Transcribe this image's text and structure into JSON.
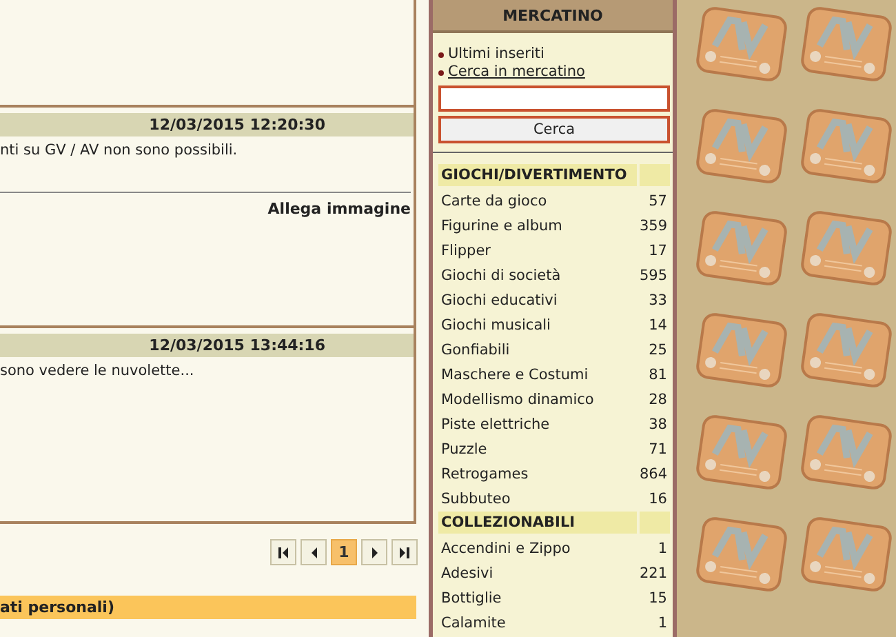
{
  "posts": [
    {
      "date": "12/03/2015 12:20:30",
      "text": "nti su GV / AV non sono possibili.",
      "attach_label": "Allega immagine"
    },
    {
      "date": "12/03/2015 13:44:16",
      "text": "sono vedere le nuvolette..."
    }
  ],
  "pagination": [
    {
      "kind": "first",
      "selected": false
    },
    {
      "kind": "prev",
      "selected": false
    },
    {
      "kind": "page",
      "label": "1",
      "selected": true
    },
    {
      "kind": "next",
      "selected": false
    },
    {
      "kind": "last",
      "selected": false
    }
  ],
  "footer_bar": {
    "text": "ati personali)"
  },
  "sidebar": {
    "title": "MERCATINO",
    "links": [
      "Ultimi inseriti",
      "Cerca in mercatino"
    ],
    "search_button": "Cerca",
    "groups": [
      {
        "title": "GIOCHI/DIVERTIMENTO",
        "items": [
          {
            "name": "Carte da gioco",
            "count": "57"
          },
          {
            "name": "Figurine e album",
            "count": "359"
          },
          {
            "name": "Flipper",
            "count": "17"
          },
          {
            "name": "Giochi di società",
            "count": "595"
          },
          {
            "name": "Giochi educativi",
            "count": "33"
          },
          {
            "name": "Giochi musicali",
            "count": "14"
          },
          {
            "name": "Gonfiabili",
            "count": "25"
          },
          {
            "name": "Maschere e Costumi",
            "count": "81"
          },
          {
            "name": "Modellismo dinamico",
            "count": "28"
          },
          {
            "name": "Piste elettriche",
            "count": "38"
          },
          {
            "name": "Puzzle",
            "count": "71"
          },
          {
            "name": "Retrogames",
            "count": "864"
          },
          {
            "name": "Subbuteo",
            "count": "16"
          }
        ]
      },
      {
        "title": "COLLEZIONABILI",
        "items": [
          {
            "name": "Accendini e Zippo",
            "count": "1"
          },
          {
            "name": "Adesivi",
            "count": "221"
          },
          {
            "name": "Bottiglie",
            "count": "15"
          },
          {
            "name": "Calamite",
            "count": "1"
          }
        ]
      }
    ]
  }
}
